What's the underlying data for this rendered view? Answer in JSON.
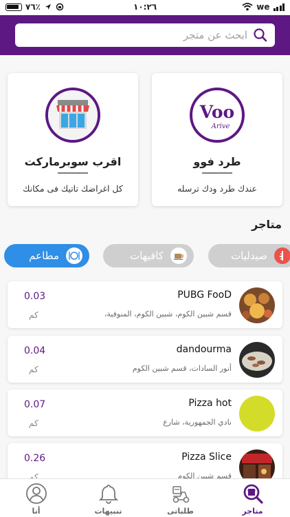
{
  "status_bar": {
    "battery_percent": "٧٦٪",
    "time": "١٠:٢٦",
    "carrier": "we"
  },
  "search": {
    "placeholder": "ابحث عن متجر",
    "icon": "search-icon"
  },
  "hero_cards": [
    {
      "title": "طرد فوو",
      "subtitle": "عندك طرد ودك ترسله",
      "logo_text": "Voo",
      "logo_sub": "Arive"
    },
    {
      "title": "اقرب سوبرماركت",
      "subtitle": "كل اغراضك تاتيك فى مكانك"
    }
  ],
  "stores_section_title": "متاجر",
  "categories": [
    {
      "label": "مطاعم",
      "icon": "restaurant-icon",
      "active": true
    },
    {
      "label": "كافيهات",
      "icon": "coffee-icon",
      "active": false
    },
    {
      "label": "صيدليات",
      "icon": "pharmacy-icon",
      "active": false
    }
  ],
  "stores": [
    {
      "name": "PUBG FooD",
      "address": "قسم شبين الكوم، شبين الكوم، المنوفية،",
      "distance": "0.03",
      "unit": "كم"
    },
    {
      "name": "dandourma",
      "address": "أنور السادات، قسم شبين الكوم",
      "distance": "0.04",
      "unit": "كم"
    },
    {
      "name": "Pizza hot",
      "address": "نادي الجمهورية، شارع",
      "distance": "0.07",
      "unit": "كم"
    },
    {
      "name": "Pizza Slice",
      "address": "قسم شبين الكوم",
      "distance": "0.26",
      "unit": "كم"
    }
  ],
  "tabs": [
    {
      "label": "متاجر",
      "icon": "store-search-icon",
      "active": true
    },
    {
      "label": "طلباتى",
      "icon": "delivery-icon",
      "active": false
    },
    {
      "label": "تنبيهات",
      "icon": "bell-icon",
      "active": false
    },
    {
      "label": "أنا",
      "icon": "profile-icon",
      "active": false
    }
  ],
  "colors": {
    "brand": "#5d1883",
    "active_pill": "#2f8ee6",
    "inactive_pill": "#cfcfcf"
  }
}
